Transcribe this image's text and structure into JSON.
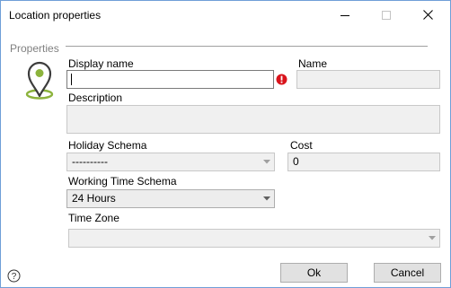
{
  "window": {
    "title": "Location properties"
  },
  "group": {
    "label": "Properties"
  },
  "form": {
    "display_name": {
      "label": "Display name",
      "value": ""
    },
    "name": {
      "label": "Name",
      "value": ""
    },
    "description": {
      "label": "Description",
      "value": ""
    },
    "holiday_schema": {
      "label": "Holiday Schema",
      "value": "----------"
    },
    "cost": {
      "label": "Cost",
      "value": "0"
    },
    "working_time_schema": {
      "label": "Working Time Schema",
      "value": "24 Hours"
    },
    "time_zone": {
      "label": "Time Zone",
      "value": ""
    }
  },
  "buttons": {
    "ok": "Ok",
    "cancel": "Cancel"
  },
  "icons": {
    "window": [
      "minimize-icon",
      "maximize-icon",
      "close-icon"
    ],
    "pin": "location-pin-icon",
    "error": "error-icon",
    "help": "help-icon",
    "dropdown": "chevron-down-icon"
  },
  "colors": {
    "pin_green": "#8cb33c",
    "pin_dark": "#3c3c3c",
    "error_red": "#d9141c",
    "window_border": "#6f9fd8"
  }
}
